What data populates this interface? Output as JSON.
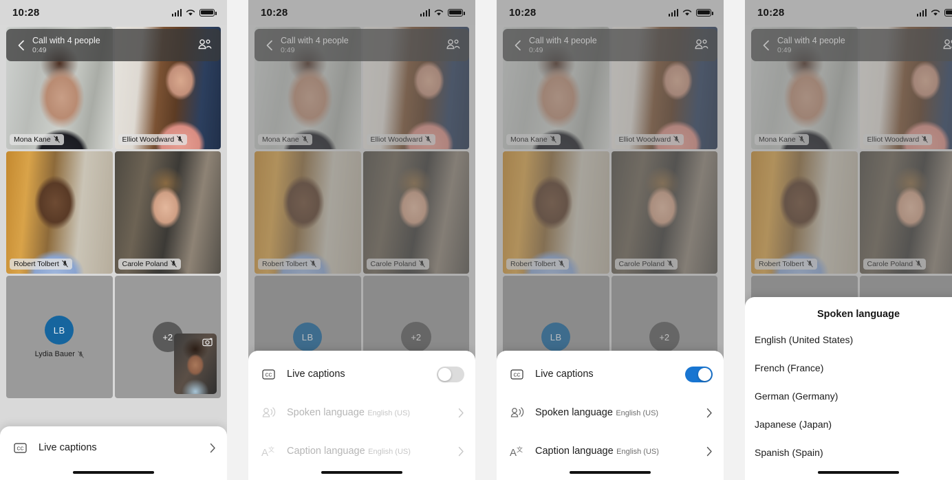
{
  "status_bar": {
    "time": "10:28",
    "icons": [
      "cellular-signal-icon",
      "wifi-icon",
      "battery-icon"
    ]
  },
  "call_header": {
    "back_icon": "chevron-left-icon",
    "title": "Call with 4 people",
    "duration": "0:49",
    "people_icon": "participants-icon"
  },
  "participants": [
    {
      "name": "Mona Kane",
      "muted": true,
      "photo": "mona"
    },
    {
      "name": "Elliot Woodward",
      "muted": true,
      "photo": "elliot"
    },
    {
      "name": "Robert Tolbert",
      "muted": true,
      "photo": "robert"
    },
    {
      "name": "Carole Poland",
      "muted": true,
      "photo": "carole"
    },
    {
      "name": "Lydia Bauer",
      "muted": true,
      "initials": "LB",
      "avatar_color": "#16659e"
    }
  ],
  "overflow_badge": "+2",
  "self_view": {
    "camera_icon": "camera-switch-icon"
  },
  "panel1": {
    "collapsed_sheet": {
      "icon": "cc-icon",
      "label": "Live captions",
      "chevron": "chevron-right-icon"
    },
    "end_call_button": {
      "label": "",
      "color": "#8c1f23"
    }
  },
  "panel2": {
    "rows": [
      {
        "icon": "cc-icon",
        "title": "Live captions",
        "control": "toggle",
        "enabled": false
      },
      {
        "icon": "spoken-language-icon",
        "title": "Spoken language",
        "subtitle": "English (US)",
        "control": "chevron",
        "disabled": true
      },
      {
        "icon": "caption-language-icon",
        "title": "Caption language",
        "subtitle": "English (US)",
        "control": "chevron",
        "disabled": true
      }
    ]
  },
  "panel3": {
    "rows": [
      {
        "icon": "cc-icon",
        "title": "Live captions",
        "control": "toggle",
        "enabled": true
      },
      {
        "icon": "spoken-language-icon",
        "title": "Spoken language",
        "subtitle": "English (US)",
        "control": "chevron",
        "disabled": false
      },
      {
        "icon": "caption-language-icon",
        "title": "Caption language",
        "subtitle": "English (US)",
        "control": "chevron",
        "disabled": false
      }
    ]
  },
  "panel4": {
    "title": "Spoken language",
    "options": [
      {
        "label": "English (United States)",
        "selected": true
      },
      {
        "label": "French (France)",
        "selected": false
      },
      {
        "label": "German (Germany)",
        "selected": false
      },
      {
        "label": "Japanese (Japan)",
        "selected": false
      },
      {
        "label": "Spanish (Spain)",
        "selected": false
      }
    ],
    "check_icon": "checkmark-icon"
  },
  "colors": {
    "accent": "#1875d1",
    "avatar": "#16659e",
    "end_call": "#8c1f23",
    "toggle_off": "#dcdcdc"
  }
}
